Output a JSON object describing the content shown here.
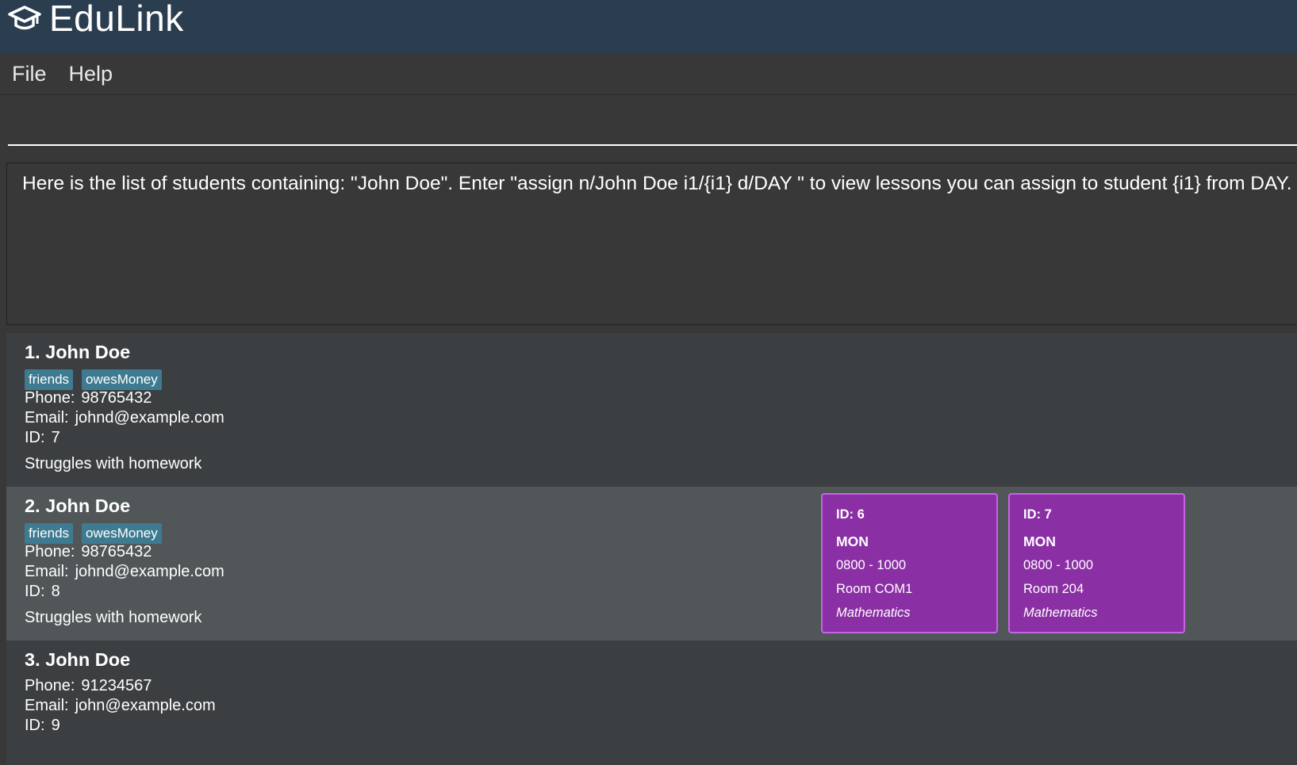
{
  "app": {
    "title": "EduLink"
  },
  "menu": {
    "items": [
      "File",
      "Help"
    ]
  },
  "command": {
    "value": ""
  },
  "result": {
    "message": "Here is the list of students containing: \"John Doe\". Enter \"assign n/John Doe i1/{i1} d/DAY \" to view lessons you can assign to student {i1} from DAY."
  },
  "labels": {
    "phone": "Phone:",
    "email": "Email:",
    "id": "ID:"
  },
  "students": [
    {
      "name": "1. John Doe",
      "tags": [
        "friends",
        "owesMoney"
      ],
      "phone": "98765432",
      "email": "johnd@example.com",
      "id": "7",
      "note": "Struggles with homework",
      "selected": false,
      "lessons": []
    },
    {
      "name": "2. John Doe",
      "tags": [
        "friends",
        "owesMoney"
      ],
      "phone": "98765432",
      "email": "johnd@example.com",
      "id": "8",
      "note": "Struggles with homework",
      "selected": true,
      "lessons": [
        {
          "id": "ID: 6",
          "day": "MON",
          "time": "0800 - 1000",
          "room": "Room COM1",
          "subject": "Mathematics"
        },
        {
          "id": "ID: 7",
          "day": "MON",
          "time": "0800 - 1000",
          "room": "Room 204",
          "subject": "Mathematics"
        }
      ]
    },
    {
      "name": "3. John Doe",
      "tags": [],
      "phone": "91234567",
      "email": "john@example.com",
      "id": "9",
      "note": "",
      "selected": false,
      "lessons": []
    }
  ],
  "colors": {
    "titlebar": "#2b3e50",
    "background": "#383838",
    "card": "#3c3f41",
    "card_selected": "#515658",
    "tag": "#3e7b91",
    "lesson_card": "#8b2fa5"
  },
  "icons": {
    "logo": "graduation-cap-icon"
  }
}
